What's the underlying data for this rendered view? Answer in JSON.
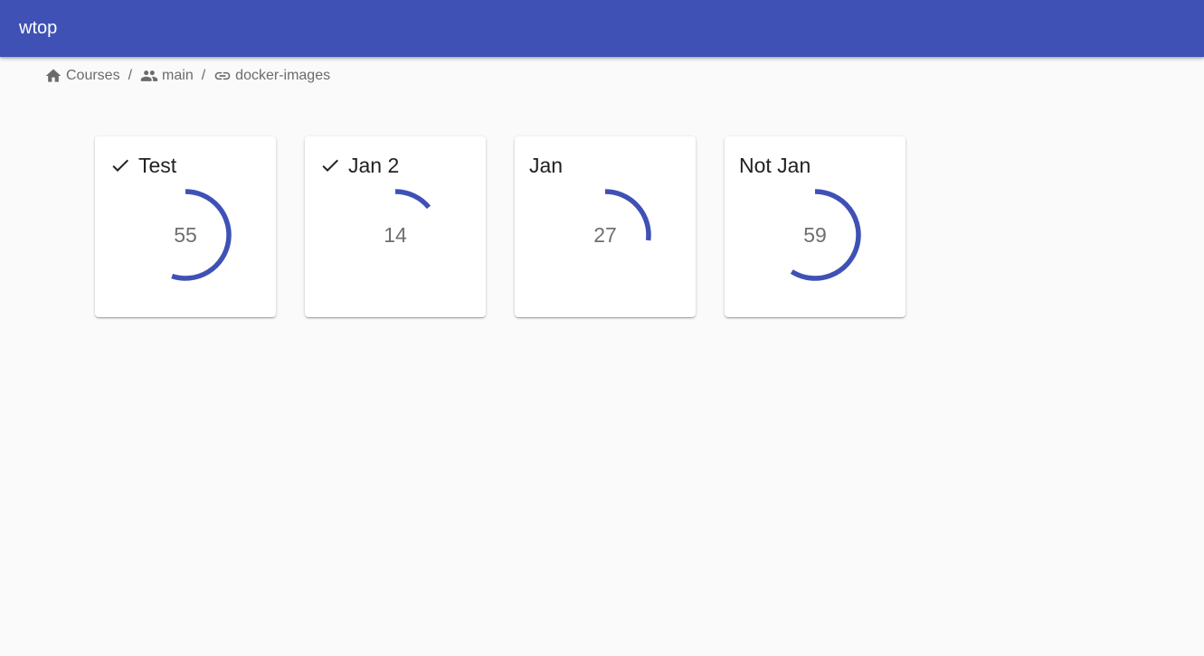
{
  "app": {
    "title": "wtop",
    "accent_color": "#3f51b5"
  },
  "breadcrumb": [
    {
      "label": "Courses",
      "icon": "home-icon"
    },
    {
      "label": "main",
      "icon": "people-icon"
    },
    {
      "label": "docker-images",
      "icon": "link-icon"
    }
  ],
  "breadcrumb_separator": "/",
  "cards": [
    {
      "title": "Test",
      "checked": true,
      "value": "55",
      "progress": 0.55
    },
    {
      "title": "Jan 2",
      "checked": true,
      "value": "14",
      "progress": 0.14
    },
    {
      "title": "Jan",
      "checked": false,
      "value": "27",
      "progress": 0.27
    },
    {
      "title": "Not Jan",
      "checked": false,
      "value": "59",
      "progress": 0.59
    }
  ]
}
